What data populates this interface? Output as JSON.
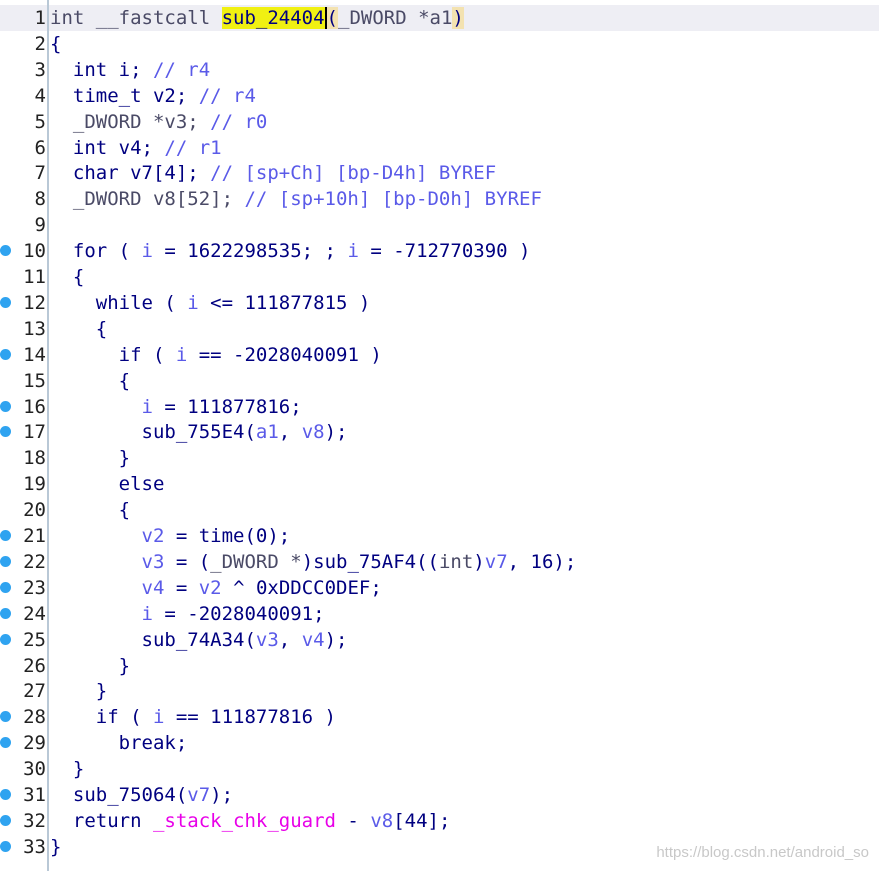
{
  "editor": {
    "lines": [
      {
        "num": "1",
        "breakpoint": false,
        "tokens": [
          {
            "t": "int __fastcall ",
            "c": "gray"
          },
          {
            "t": "sub_24404",
            "c": "highlight"
          },
          {
            "t": "(",
            "c": "paren",
            "cursor": true
          },
          {
            "t": "_DWORD *a1",
            "c": "gray"
          },
          {
            "t": ")",
            "c": "paren"
          }
        ]
      },
      {
        "num": "2",
        "breakpoint": false,
        "tokens": [
          {
            "t": "{",
            "c": "code"
          }
        ]
      },
      {
        "num": "3",
        "breakpoint": false,
        "tokens": [
          {
            "t": "  int i; ",
            "c": "code"
          },
          {
            "t": "// r4",
            "c": "comment"
          }
        ]
      },
      {
        "num": "4",
        "breakpoint": false,
        "tokens": [
          {
            "t": "  time_t v2; ",
            "c": "code"
          },
          {
            "t": "// r4",
            "c": "comment"
          }
        ]
      },
      {
        "num": "5",
        "breakpoint": false,
        "tokens": [
          {
            "t": "  _DWORD *v3; ",
            "c": "gray"
          },
          {
            "t": "// r0",
            "c": "comment"
          }
        ]
      },
      {
        "num": "6",
        "breakpoint": false,
        "tokens": [
          {
            "t": "  int v4; ",
            "c": "code"
          },
          {
            "t": "// r1",
            "c": "comment"
          }
        ]
      },
      {
        "num": "7",
        "breakpoint": false,
        "tokens": [
          {
            "t": "  char v7[4]; ",
            "c": "code"
          },
          {
            "t": "// [sp+Ch] [bp-D4h] BYREF",
            "c": "comment"
          }
        ]
      },
      {
        "num": "8",
        "breakpoint": false,
        "tokens": [
          {
            "t": "  _DWORD v8[52]; ",
            "c": "gray"
          },
          {
            "t": "// [sp+10h] [bp-D0h] BYREF",
            "c": "comment"
          }
        ]
      },
      {
        "num": "9",
        "breakpoint": false,
        "tokens": []
      },
      {
        "num": "10",
        "breakpoint": true,
        "tokens": [
          {
            "t": "  for ( ",
            "c": "code"
          },
          {
            "t": "i",
            "c": "var"
          },
          {
            "t": " = 1622298535; ; ",
            "c": "code"
          },
          {
            "t": "i",
            "c": "var"
          },
          {
            "t": " = -712770390 )",
            "c": "code"
          }
        ]
      },
      {
        "num": "11",
        "breakpoint": false,
        "tokens": [
          {
            "t": "  {",
            "c": "code"
          }
        ]
      },
      {
        "num": "12",
        "breakpoint": true,
        "tokens": [
          {
            "t": "    while ( ",
            "c": "code"
          },
          {
            "t": "i",
            "c": "var"
          },
          {
            "t": " <= 111877815 )",
            "c": "code"
          }
        ]
      },
      {
        "num": "13",
        "breakpoint": false,
        "tokens": [
          {
            "t": "    {",
            "c": "code"
          }
        ]
      },
      {
        "num": "14",
        "breakpoint": true,
        "tokens": [
          {
            "t": "      if ( ",
            "c": "code"
          },
          {
            "t": "i",
            "c": "var"
          },
          {
            "t": " == -2028040091 )",
            "c": "code"
          }
        ]
      },
      {
        "num": "15",
        "breakpoint": false,
        "tokens": [
          {
            "t": "      {",
            "c": "code"
          }
        ]
      },
      {
        "num": "16",
        "breakpoint": true,
        "tokens": [
          {
            "t": "        ",
            "c": "code"
          },
          {
            "t": "i",
            "c": "var"
          },
          {
            "t": " = 111877816;",
            "c": "code"
          }
        ]
      },
      {
        "num": "17",
        "breakpoint": true,
        "tokens": [
          {
            "t": "        sub_755E4(",
            "c": "code"
          },
          {
            "t": "a1",
            "c": "var"
          },
          {
            "t": ", ",
            "c": "code"
          },
          {
            "t": "v8",
            "c": "var"
          },
          {
            "t": ");",
            "c": "code"
          }
        ]
      },
      {
        "num": "18",
        "breakpoint": false,
        "tokens": [
          {
            "t": "      }",
            "c": "code"
          }
        ]
      },
      {
        "num": "19",
        "breakpoint": false,
        "tokens": [
          {
            "t": "      else",
            "c": "code"
          }
        ]
      },
      {
        "num": "20",
        "breakpoint": false,
        "tokens": [
          {
            "t": "      {",
            "c": "code"
          }
        ]
      },
      {
        "num": "21",
        "breakpoint": true,
        "tokens": [
          {
            "t": "        ",
            "c": "code"
          },
          {
            "t": "v2",
            "c": "var"
          },
          {
            "t": " = time(0);",
            "c": "code"
          }
        ]
      },
      {
        "num": "22",
        "breakpoint": true,
        "tokens": [
          {
            "t": "        ",
            "c": "code"
          },
          {
            "t": "v3",
            "c": "var"
          },
          {
            "t": " = (",
            "c": "code"
          },
          {
            "t": "_DWORD *",
            "c": "gray"
          },
          {
            "t": ")sub_75AF4((",
            "c": "code"
          },
          {
            "t": "int",
            "c": "gray"
          },
          {
            "t": ")",
            "c": "code"
          },
          {
            "t": "v7",
            "c": "var"
          },
          {
            "t": ", 16);",
            "c": "code"
          }
        ]
      },
      {
        "num": "23",
        "breakpoint": true,
        "tokens": [
          {
            "t": "        ",
            "c": "code"
          },
          {
            "t": "v4",
            "c": "var"
          },
          {
            "t": " = ",
            "c": "code"
          },
          {
            "t": "v2",
            "c": "var"
          },
          {
            "t": " ^ 0xDDCC0DEF;",
            "c": "code"
          }
        ]
      },
      {
        "num": "24",
        "breakpoint": true,
        "tokens": [
          {
            "t": "        ",
            "c": "code"
          },
          {
            "t": "i",
            "c": "var"
          },
          {
            "t": " = -2028040091;",
            "c": "code"
          }
        ]
      },
      {
        "num": "25",
        "breakpoint": true,
        "tokens": [
          {
            "t": "        sub_74A34(",
            "c": "code"
          },
          {
            "t": "v3",
            "c": "var"
          },
          {
            "t": ", ",
            "c": "code"
          },
          {
            "t": "v4",
            "c": "var"
          },
          {
            "t": ");",
            "c": "code"
          }
        ]
      },
      {
        "num": "26",
        "breakpoint": false,
        "tokens": [
          {
            "t": "      }",
            "c": "code"
          }
        ]
      },
      {
        "num": "27",
        "breakpoint": false,
        "tokens": [
          {
            "t": "    }",
            "c": "code"
          }
        ]
      },
      {
        "num": "28",
        "breakpoint": true,
        "tokens": [
          {
            "t": "    if ( ",
            "c": "code"
          },
          {
            "t": "i",
            "c": "var"
          },
          {
            "t": " == 111877816 )",
            "c": "code"
          }
        ]
      },
      {
        "num": "29",
        "breakpoint": true,
        "tokens": [
          {
            "t": "      break;",
            "c": "code"
          }
        ]
      },
      {
        "num": "30",
        "breakpoint": false,
        "tokens": [
          {
            "t": "  }",
            "c": "code"
          }
        ]
      },
      {
        "num": "31",
        "breakpoint": true,
        "tokens": [
          {
            "t": "  sub_75064(",
            "c": "code"
          },
          {
            "t": "v7",
            "c": "var"
          },
          {
            "t": ");",
            "c": "code"
          }
        ]
      },
      {
        "num": "32",
        "breakpoint": true,
        "tokens": [
          {
            "t": "  return ",
            "c": "code"
          },
          {
            "t": "_stack_chk_guard",
            "c": "magenta"
          },
          {
            "t": " - ",
            "c": "code"
          },
          {
            "t": "v8",
            "c": "var"
          },
          {
            "t": "[44];",
            "c": "code"
          }
        ]
      },
      {
        "num": "33",
        "breakpoint": true,
        "tokens": [
          {
            "t": "}",
            "c": "code"
          }
        ]
      }
    ]
  },
  "watermark": "https://blog.csdn.net/android_so",
  "colors": {
    "code": "#000080",
    "variable": "#5a5ae8",
    "comment": "#5a5ae8",
    "type_gray": "#4a4a66",
    "string_magenta": "#e800e8",
    "highlight": "#f0f012",
    "breakpoint": "#2fa3f0"
  }
}
